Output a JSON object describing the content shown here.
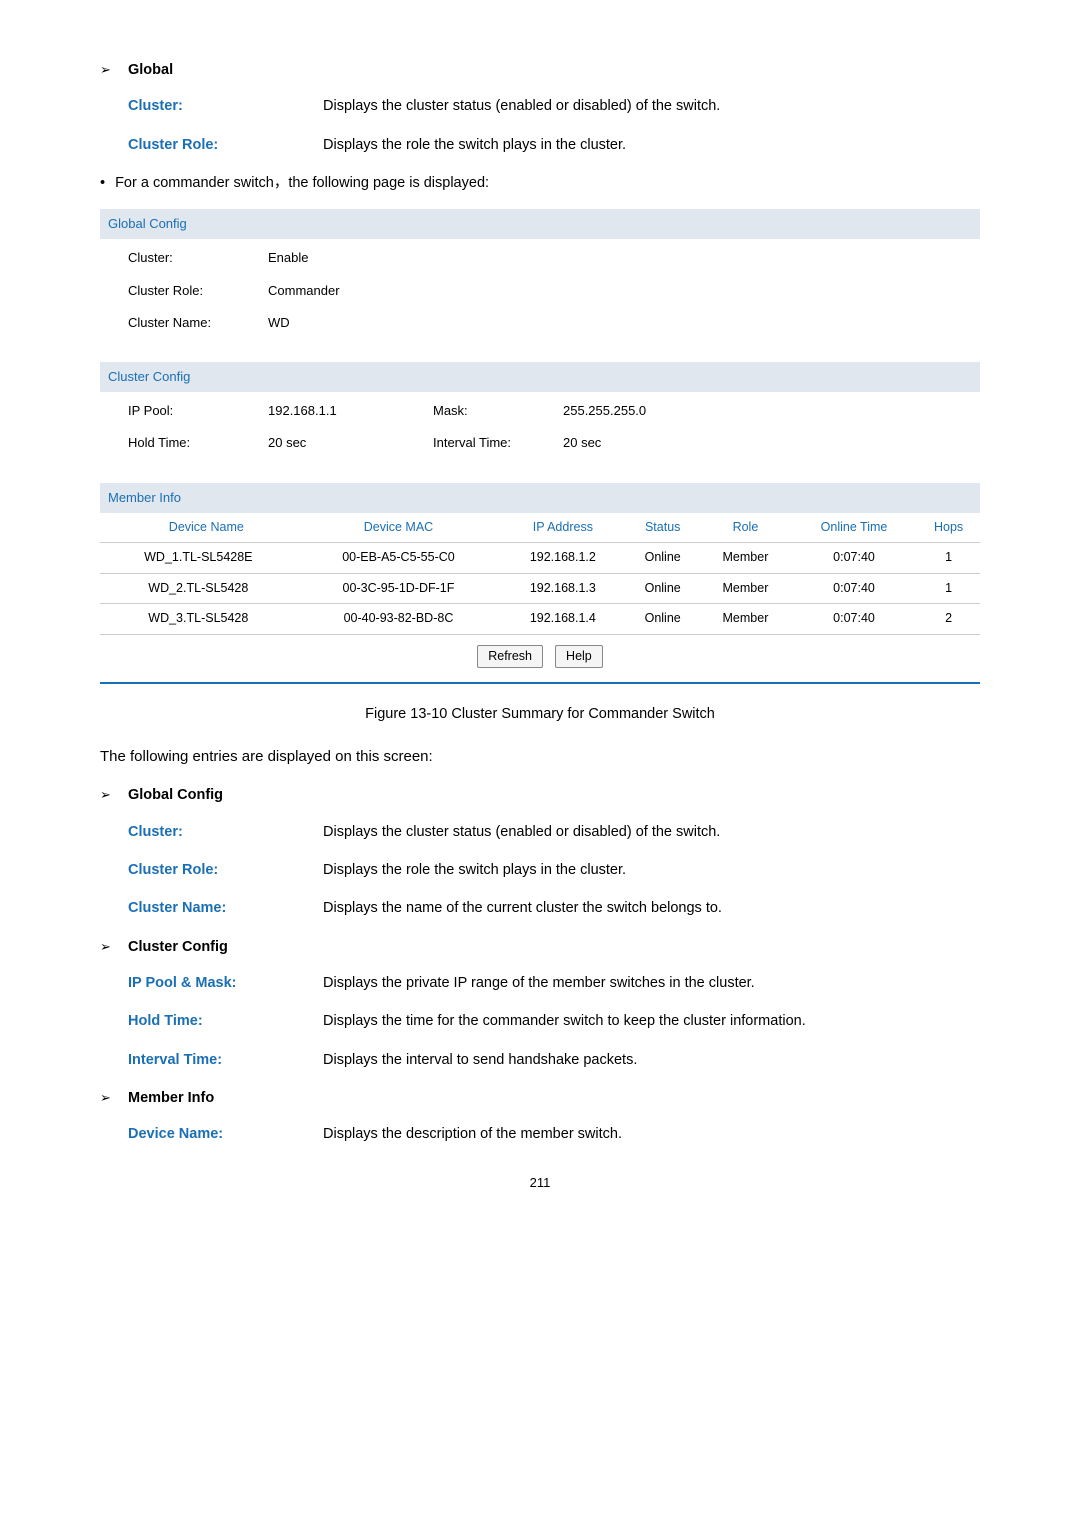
{
  "top": {
    "global_heading": "Global",
    "cluster_label": "Cluster:",
    "cluster_desc": "Displays the cluster status (enabled or disabled) of the switch.",
    "cluster_role_label": "Cluster Role:",
    "cluster_role_desc": "Displays the role the switch plays in the cluster.",
    "commander_line": "For a commander switch，the following page is displayed:"
  },
  "screenshot": {
    "global_config_header": "Global Config",
    "cluster_label": "Cluster:",
    "cluster_value": "Enable",
    "cluster_role_label": "Cluster Role:",
    "cluster_role_value": "Commander",
    "cluster_name_label": "Cluster Name:",
    "cluster_name_value": "WD",
    "cluster_config_header": "Cluster Config",
    "ip_pool_label": "IP Pool:",
    "ip_pool_value": "192.168.1.1",
    "mask_label": "Mask:",
    "mask_value": "255.255.255.0",
    "hold_time_label": "Hold Time:",
    "hold_time_value": "20 sec",
    "interval_time_label": "Interval Time:",
    "interval_time_value": "20 sec",
    "member_info_header": "Member Info",
    "headers": {
      "device_name": "Device Name",
      "device_mac": "Device MAC",
      "ip_address": "IP Address",
      "status": "Status",
      "role": "Role",
      "online_time": "Online Time",
      "hops": "Hops"
    },
    "rows": [
      {
        "device_name": "WD_1.TL-SL5428E",
        "device_mac": "00-EB-A5-C5-55-C0",
        "ip_address": "192.168.1.2",
        "status": "Online",
        "role": "Member",
        "online_time": "0:07:40",
        "hops": "1"
      },
      {
        "device_name": "WD_2.TL-SL5428",
        "device_mac": "00-3C-95-1D-DF-1F",
        "ip_address": "192.168.1.3",
        "status": "Online",
        "role": "Member",
        "online_time": "0:07:40",
        "hops": "1"
      },
      {
        "device_name": "WD_3.TL-SL5428",
        "device_mac": "00-40-93-82-BD-8C",
        "ip_address": "192.168.1.4",
        "status": "Online",
        "role": "Member",
        "online_time": "0:07:40",
        "hops": "2"
      }
    ],
    "refresh_btn": "Refresh",
    "help_btn": "Help"
  },
  "figure_caption": "Figure 13-10 Cluster Summary for Commander Switch",
  "entries_line": "The following entries are displayed on this screen:",
  "sections": {
    "global_config": {
      "heading": "Global Config",
      "cluster_label": "Cluster:",
      "cluster_desc": "Displays the cluster status (enabled or disabled) of the switch.",
      "cluster_role_label": "Cluster Role:",
      "cluster_role_desc": "Displays the role the switch plays in the cluster.",
      "cluster_name_label": "Cluster Name:",
      "cluster_name_desc": "Displays the name of the current cluster the switch belongs to."
    },
    "cluster_config": {
      "heading": "Cluster Config",
      "ip_pool_label": "IP Pool & Mask:",
      "ip_pool_desc": "Displays the private IP range of the member switches in the cluster.",
      "hold_time_label": "Hold Time:",
      "hold_time_desc": "Displays the time for the commander switch to keep the cluster information.",
      "interval_time_label": "Interval Time:",
      "interval_time_desc": "Displays the interval to send handshake packets."
    },
    "member_info": {
      "heading": "Member Info",
      "device_name_label": "Device Name:",
      "device_name_desc": "Displays the description of the member switch."
    }
  },
  "page_number": "211"
}
